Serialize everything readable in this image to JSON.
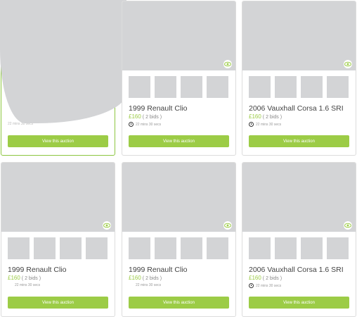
{
  "cards": [
    {
      "title": "",
      "price": "",
      "bids": "",
      "timer": "22 mins 30 secs",
      "button": "View this auction"
    },
    {
      "title": "1999 Renault Clio",
      "price": "£160",
      "bids": "( 2 bids )",
      "timer": "22 mins 30 secs",
      "button": "View this auction"
    },
    {
      "title": "2006 Vauxhall Corsa 1.6 SRI",
      "price": "£160",
      "bids": "( 2 bids )",
      "timer": "22 mins 30 secs",
      "button": "View this auction"
    },
    {
      "title": "1999 Renault Clio",
      "price": "£160",
      "bids": "( 2 bids )",
      "timer": "22 mins 30 secs",
      "button": "View this auction"
    },
    {
      "title": "1999 Renault Clio",
      "price": "£160",
      "bids": "( 2 bids )",
      "timer": "22 mins 30 secs",
      "button": "View this auction"
    },
    {
      "title": "2006 Vauxhall Corsa 1.6 SRI",
      "price": "£160",
      "bids": "( 2 bids )",
      "timer": "22 mins 30 secs",
      "button": "View this auction"
    }
  ],
  "colors": {
    "accent": "#9ccc46",
    "placeholder": "#d3d4d6",
    "border": "#dcdcdc"
  },
  "icons": {
    "watch": "eye-icon",
    "timer": "clock-icon"
  }
}
